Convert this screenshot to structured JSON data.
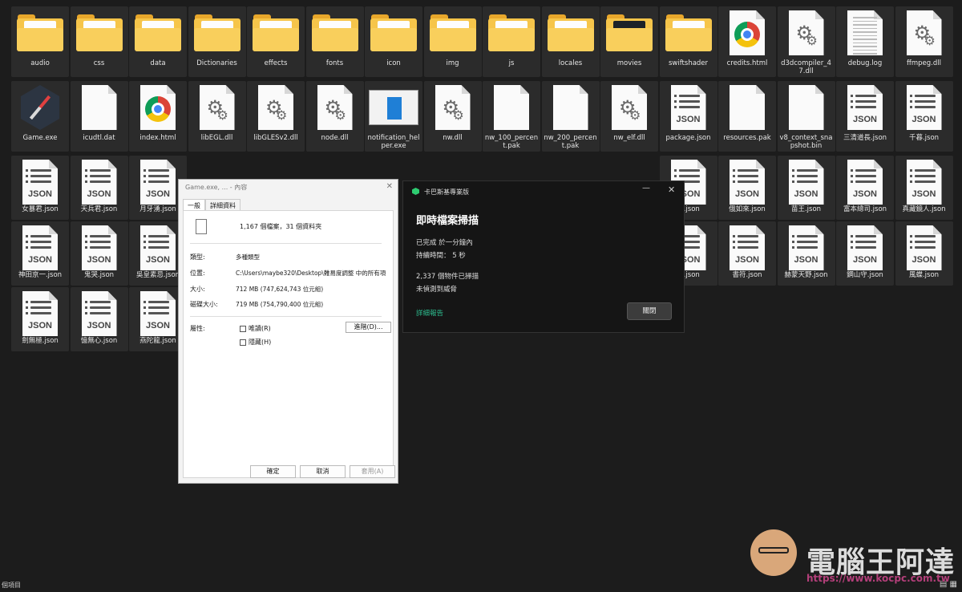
{
  "rows": [
    [
      "audio",
      "css",
      "data",
      "Dictionaries",
      "effects",
      "fonts",
      "icon",
      "img",
      "js",
      "locales",
      "movies",
      "swiftshader",
      "credits.html",
      "d3dcompiler_47.dll",
      "debug.log",
      "ffmpeg.dll"
    ],
    [
      "Game.exe",
      "icudtl.dat",
      "index.html",
      "libEGL.dll",
      "libGLESv2.dll",
      "node.dll",
      "notification_helper.exe",
      "nw.dll",
      "nw_100_percent.pak",
      "nw_200_percent.pak",
      "nw_elf.dll",
      "package.json",
      "resources.pak",
      "v8_context_snapshot.bin",
      "三清道長.json",
      "千暮.json"
    ],
    [
      "女暴君.json",
      "天兵君.json",
      "月牙湧.json",
      "",
      "",
      "",
      "",
      "",
      "",
      "",
      "",
      "霸.json",
      "俄如來.json",
      "苗王.json",
      "富本總司.json",
      "真藏鏡人.json"
    ],
    [
      "神田京一.json",
      "鬼哭.json",
      "吳皇素忌.json",
      "",
      "",
      "",
      "",
      "",
      "",
      "",
      "",
      "王.json",
      "書符.json",
      "赫蒙天野.json",
      "鋼山守.json",
      "風蝶.json"
    ],
    [
      "劍無極.json",
      "憶無心.json",
      "燕陀龍.json"
    ]
  ],
  "properties": {
    "title": "Game.exe, ... - 內容",
    "tab_general": "一般",
    "tab_details": "詳細資料",
    "summary": "1,167 個檔案，31 個資料夾",
    "type_label": "類型:",
    "type_value": "多種類型",
    "location_label": "位置:",
    "location_value": "C:\\Users\\maybe320\\Desktop\\難易度調整 中的所有項",
    "size_label": "大小:",
    "size_value": "712 MB (747,624,743 位元組)",
    "disk_label": "磁碟大小:",
    "disk_value": "719 MB (754,790,400 位元組)",
    "attr_label": "屬性:",
    "readonly": "唯讀(R)",
    "hidden": "隱藏(H)",
    "advanced": "進階(D)...",
    "ok": "確定",
    "cancel": "取消",
    "apply": "套用(A)"
  },
  "kaspersky": {
    "app_title": "卡巴斯基專業版",
    "heading": "即時檔案掃描",
    "line1": "已完成 於一分鐘內",
    "line2": "持續時間： 5 秒",
    "line3": "2,337 個物件已掃描",
    "line4": "未偵測到威脅",
    "link": "詳細報告",
    "close_btn": "關閉",
    "accent": "#2dbd8f"
  },
  "status": {
    "items_text": "個項目"
  },
  "watermark": {
    "title": "電腦王阿達",
    "url": "https://www.kocpc.com.tw"
  }
}
